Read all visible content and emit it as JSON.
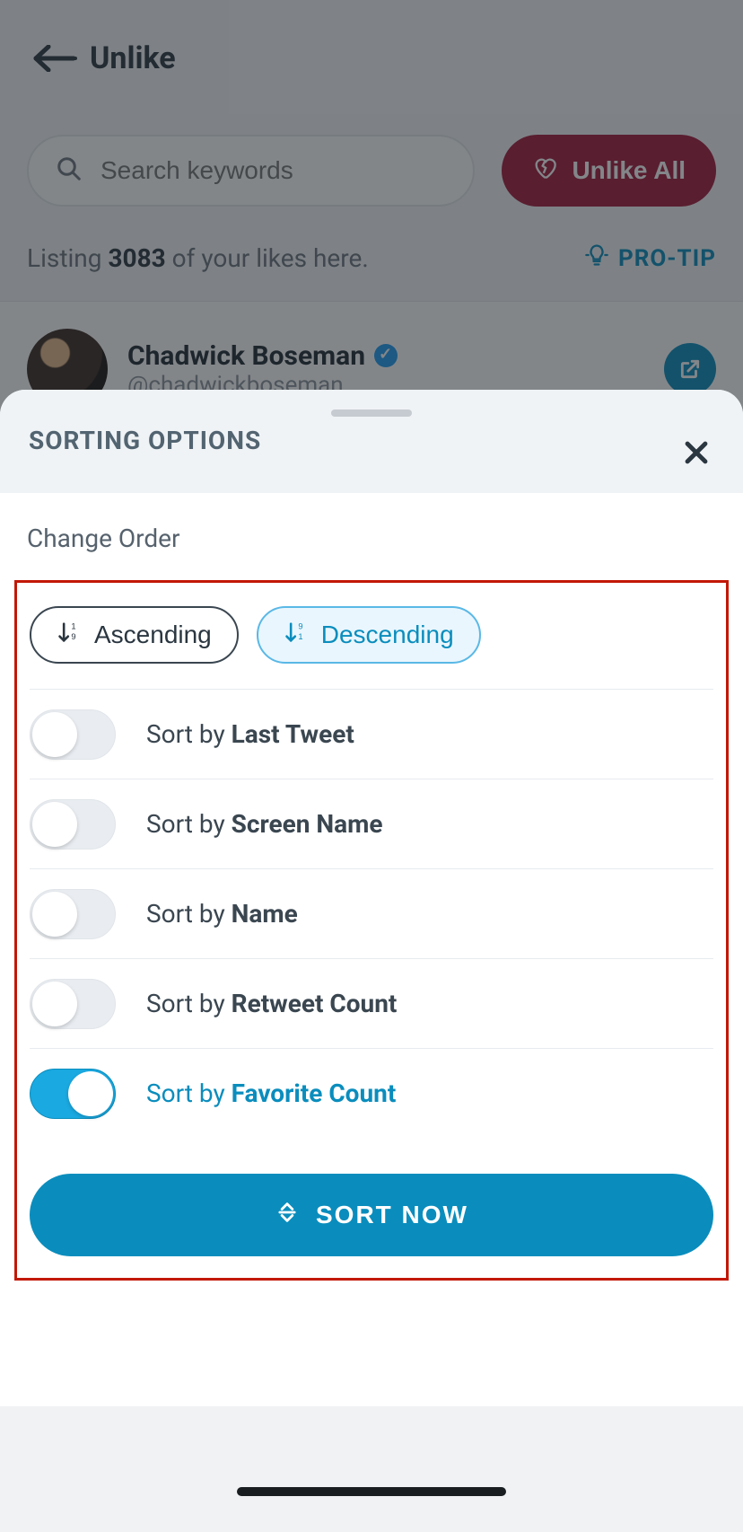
{
  "header": {
    "title": "Unlike"
  },
  "search": {
    "placeholder": "Search keywords",
    "unlike_all": "Unlike All"
  },
  "listing": {
    "prefix": "Listing ",
    "count": "3083",
    "suffix": " of your likes here.",
    "pro_tip": "PRO-TIP"
  },
  "tweet": {
    "name": "Chadwick Boseman",
    "handle": "@chadwickboseman"
  },
  "sheet": {
    "title": "SORTING OPTIONS",
    "change_order": "Change Order",
    "ascending": "Ascending",
    "descending": "Descending",
    "sort_by_prefix": "Sort by ",
    "options": [
      {
        "label": "Last Tweet",
        "on": false
      },
      {
        "label": "Screen Name",
        "on": false
      },
      {
        "label": "Name",
        "on": false
      },
      {
        "label": "Retweet Count",
        "on": false
      },
      {
        "label": "Favorite Count",
        "on": true
      }
    ],
    "sort_now": "SORT NOW",
    "selected_order": "descending"
  }
}
